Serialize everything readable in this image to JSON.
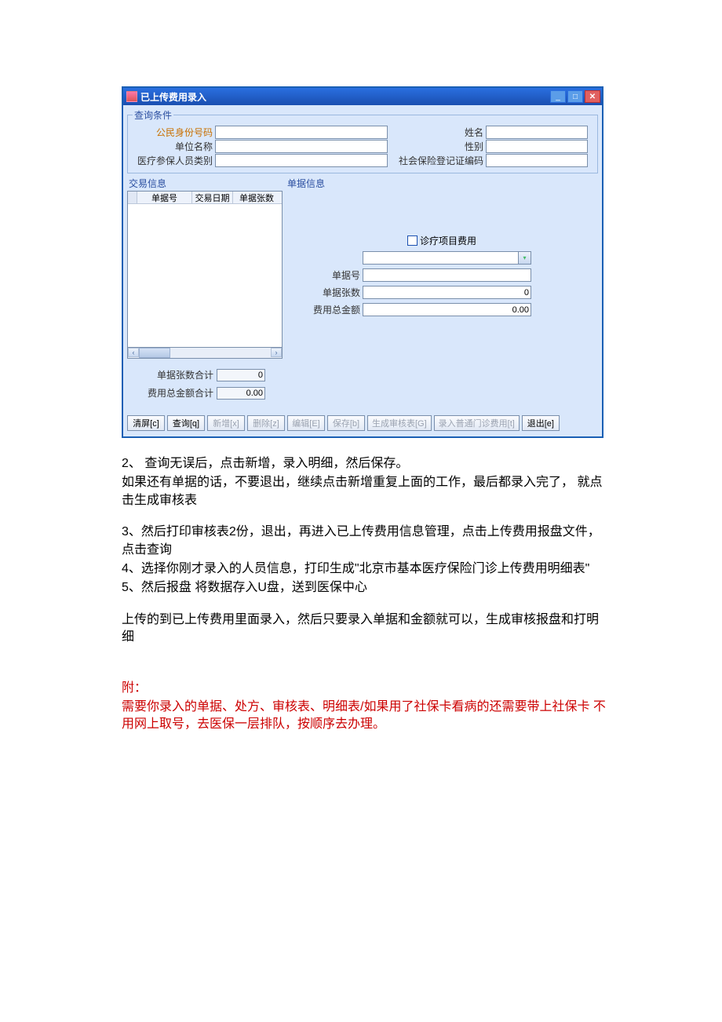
{
  "window": {
    "title": "已上传费用录入"
  },
  "query": {
    "legend": "查询条件",
    "id_label": "公民身份号码",
    "name_label": "姓名",
    "unit_label": "单位名称",
    "gender_label": "性别",
    "insured_type_label": "医疗参保人员类别",
    "ssn_label": "社会保险登记证编码"
  },
  "trans": {
    "header": "交易信息",
    "col1": "单据号",
    "col2": "交易日期",
    "col3": "单据张数",
    "sum_count_label": "单据张数合计",
    "sum_count_value": "0",
    "sum_amount_label": "费用总金额合计",
    "sum_amount_value": "0.00"
  },
  "bill": {
    "header": "单据信息",
    "check_label": "诊疗项目费用",
    "bill_no_label": "单据号",
    "bill_count_label": "单据张数",
    "bill_count_value": "0",
    "total_label": "费用总金额",
    "total_value": "0.00"
  },
  "buttons": {
    "clear": "清屏[c]",
    "query": "查询[q]",
    "new": "新增[x]",
    "delete": "删除[z]",
    "edit": "编辑[E]",
    "save": "保存[b]",
    "gen": "生成审核表[G]",
    "normal": "录入普通门诊费用[t]",
    "exit": "退出[e]"
  },
  "doc": {
    "p1": "2、 查询无误后，点击新增，录入明细，然后保存。",
    "p2": "如果还有单据的话，不要退出，继续点击新增重复上面的工作，最后都录入完了， 就点击生成审核表",
    "p3": "3、然后打印审核表2份，退出，再进入已上传费用信息管理，点击上传费用报盘文件，点击查询",
    "p4": "4、选择你刚才录入的人员信息，打印生成\"北京市基本医疗保险门诊上传费用明细表\"",
    "p5": "5、然后报盘 将数据存入U盘，送到医保中心",
    "p6": "上传的到已上传费用里面录入，然后只要录入单据和金额就可以，生成审核报盘和打明细",
    "p7": "附：",
    "p8": "需要你录入的单据、处方、审核表、明细表/如果用了社保卡看病的还需要带上社保卡 不用网上取号，去医保一层排队，按顺序去办理。"
  }
}
